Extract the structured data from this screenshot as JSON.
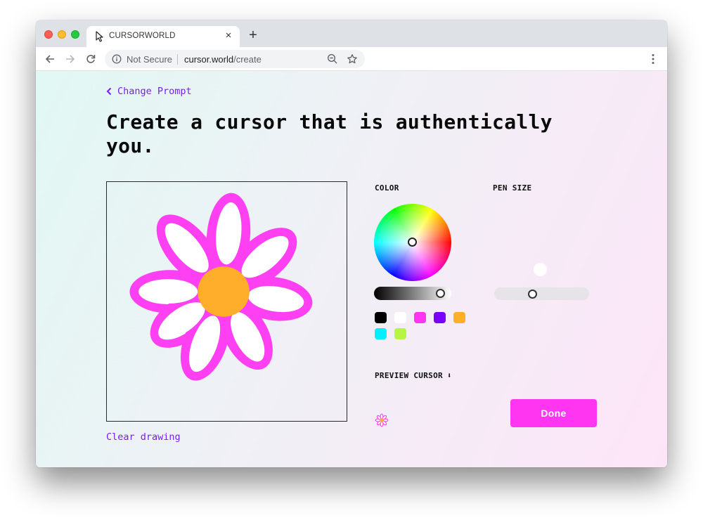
{
  "browser": {
    "tab_title": "CURSORWORLD",
    "tab_close": "×",
    "new_tab": "+",
    "omnibox": {
      "security_label": "Not Secure",
      "url_host": "cursor.world",
      "url_path": "/create"
    }
  },
  "page": {
    "back_link": "Change Prompt",
    "headline": "Create a cursor that is authentically you.",
    "clear_link": "Clear drawing",
    "color_label": "COLOR",
    "pen_size_label": "PEN SIZE",
    "preview_label": "PREVIEW CURSOR",
    "preview_arrow": "⬇",
    "done_button": "Done"
  },
  "color_picker": {
    "selected_color": "#ffffff",
    "brightness_percent": 93,
    "swatches": [
      "#000000",
      "#ffffff",
      "#ff35f2",
      "#7a00ff",
      "#ffae28",
      "#00f0ff",
      "#b6f542"
    ]
  },
  "pen_size": {
    "value_percent": 39
  },
  "drawing": {
    "description": "flower with eight white petals outlined in pink and an orange center",
    "petal_outline_color": "#ff3ff2",
    "petal_fill_color": "#ffffff",
    "center_color": "#ffae2b"
  },
  "colors": {
    "accent_purple": "#7a1cf5",
    "done_button": "#ff35f2"
  }
}
